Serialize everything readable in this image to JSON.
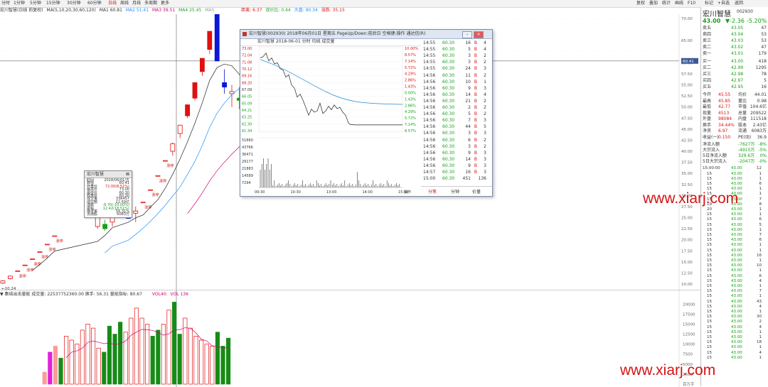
{
  "toolbar": {
    "periods": [
      "分时",
      "1分钟",
      "5分钟",
      "15分钟",
      "30分钟",
      "60分钟",
      "日线",
      "周线",
      "月线",
      "多周期",
      "更多"
    ],
    "right_tabs": [
      "复权",
      "叠加",
      "统计",
      "画线",
      "F10",
      "标记",
      "+自选",
      "返回"
    ]
  },
  "infobar": {
    "stock": "宏川智慧(日线 前复权)",
    "params": "MA(5,10,20,30,60,120)",
    "ma1": "MA1 60.81",
    "ma2": "MA2 51.41",
    "ma3": "MA3 39.51",
    "ma4": "MA4 25.45",
    "ma5": "MA5",
    "extra1": "距离: 6.37",
    "extra2": "现价比: 0.44",
    "extra3": "大盘: 90.34",
    "extra4": "涨跌: 35.15"
  },
  "price_axis": [
    "70.00",
    "65.00",
    "60.00",
    "57.50",
    "55.00",
    "52.50",
    "50.00",
    "47.50",
    "45.00",
    "42.50",
    "40.00",
    "37.50",
    "35.00",
    "32.50",
    "30.00",
    "27.50",
    "25.00",
    "22.50",
    "20.00",
    "17.50",
    "15.00",
    "12.50",
    "10.00"
  ],
  "main_chart": {
    "cursor_price": "60.41",
    "high_label": "73.00",
    "low_label": "10.24",
    "limit_up_label": "涨停"
  },
  "volume": {
    "info": "▼ 集结出击量能 成交量: 22537752360.00 换手: 56.31 量能指标: 80.67",
    "vol_label": "VOL40:",
    "vol_value": "VOL 136",
    "axis": [
      "20000",
      "17500",
      "15000",
      "12500",
      "10000",
      "7500",
      "5000",
      "2500"
    ],
    "unit": "百万手",
    "bars": [
      {
        "v": 3000,
        "c": "pink"
      },
      {
        "v": 8000,
        "c": "magenta"
      },
      {
        "v": 9500,
        "c": "pink"
      },
      {
        "v": 6500,
        "c": "green"
      },
      {
        "v": 12000,
        "c": "red"
      },
      {
        "v": 11000,
        "c": "red"
      },
      {
        "v": 10000,
        "c": "red"
      },
      {
        "v": 13500,
        "c": "red"
      },
      {
        "v": 15000,
        "c": "red"
      },
      {
        "v": 14000,
        "c": "red"
      },
      {
        "v": 9000,
        "c": "red"
      },
      {
        "v": 8000,
        "c": "green"
      },
      {
        "v": 14500,
        "c": "green"
      },
      {
        "v": 12500,
        "c": "green"
      },
      {
        "v": 15500,
        "c": "green"
      },
      {
        "v": 13000,
        "c": "red"
      },
      {
        "v": 16500,
        "c": "red"
      },
      {
        "v": 19000,
        "c": "red"
      },
      {
        "v": 16500,
        "c": "red"
      },
      {
        "v": 15000,
        "c": "red"
      },
      {
        "v": 12000,
        "c": "green"
      },
      {
        "v": 13500,
        "c": "green"
      },
      {
        "v": 15000,
        "c": "red"
      },
      {
        "v": 18500,
        "c": "red"
      },
      {
        "v": 20500,
        "c": "green"
      },
      {
        "v": 12500,
        "c": "green"
      },
      {
        "v": 16500,
        "c": "red"
      },
      {
        "v": 14000,
        "c": "red"
      },
      {
        "v": 12000,
        "c": "red"
      },
      {
        "v": 11000,
        "c": "red"
      },
      {
        "v": 10000,
        "c": "red"
      },
      {
        "v": 9500,
        "c": "red"
      },
      {
        "v": 13000,
        "c": "green"
      },
      {
        "v": 9500,
        "c": "green"
      },
      {
        "v": 11500,
        "c": "green"
      }
    ]
  },
  "candles": [
    {
      "o": 10.2,
      "h": 10.9,
      "l": 10.0,
      "c": 10.7,
      "col": "red"
    },
    {
      "o": 11.2,
      "h": 11.8,
      "l": 11.0,
      "c": 11.8,
      "col": "red"
    },
    {
      "o": 13.0,
      "h": 13.0,
      "l": 13.0,
      "c": 13.0,
      "col": "red"
    },
    {
      "o": 14.3,
      "h": 14.3,
      "l": 14.3,
      "c": 14.3,
      "col": "red"
    },
    {
      "o": 15.7,
      "h": 15.7,
      "l": 15.7,
      "c": 15.7,
      "col": "red"
    },
    {
      "o": 17.3,
      "h": 17.3,
      "l": 17.3,
      "c": 17.3,
      "col": "red"
    },
    {
      "o": 19.0,
      "h": 19.0,
      "l": 19.0,
      "c": 19.0,
      "col": "red"
    },
    {
      "o": 20.9,
      "h": 20.9,
      "l": 20.9,
      "c": 20.9,
      "col": "red"
    },
    {
      "o": 23.0,
      "h": 25.5,
      "l": 22.5,
      "c": 25.3,
      "col": "red"
    },
    {
      "o": 23.5,
      "h": 24.5,
      "l": 22.0,
      "c": 22.5,
      "col": "green"
    },
    {
      "o": 24.0,
      "h": 26.5,
      "l": 23.0,
      "c": 26.0,
      "col": "red"
    },
    {
      "o": 25.0,
      "h": 25.0,
      "l": 25.0,
      "c": 25.0,
      "col": "blue"
    },
    {
      "o": 26.5,
      "h": 27.5,
      "l": 24.0,
      "c": 26.0,
      "col": "red"
    },
    {
      "o": 28.5,
      "h": 28.5,
      "l": 28.5,
      "c": 28.5,
      "col": "red"
    },
    {
      "o": 31.3,
      "h": 31.3,
      "l": 31.3,
      "c": 31.3,
      "col": "red"
    },
    {
      "o": 34.5,
      "h": 34.5,
      "l": 34.5,
      "c": 34.5,
      "col": "red"
    },
    {
      "o": 37.9,
      "h": 37.9,
      "l": 37.9,
      "c": 37.9,
      "col": "red"
    },
    {
      "o": 40.0,
      "h": 42.0,
      "l": 39.0,
      "c": 41.7,
      "col": "red"
    },
    {
      "o": 44.0,
      "h": 46.0,
      "l": 43.0,
      "c": 45.9,
      "col": "red"
    },
    {
      "o": 48.0,
      "h": 50.5,
      "l": 47.5,
      "c": 50.5,
      "col": "red"
    },
    {
      "o": 52.0,
      "h": 55.5,
      "l": 51.5,
      "c": 55.5,
      "col": "red"
    },
    {
      "o": 58.0,
      "h": 61.0,
      "l": 57.0,
      "c": 61.0,
      "col": "red"
    },
    {
      "o": 63.0,
      "h": 67.0,
      "l": 62.0,
      "c": 67.1,
      "col": "red"
    },
    {
      "o": 73.0,
      "h": 73.0,
      "l": 60.4,
      "c": 60.4,
      "col": "blue"
    },
    {
      "o": 55.5,
      "h": 58.5,
      "l": 53.0,
      "c": 54.5,
      "col": "blue"
    },
    {
      "o": 53.0,
      "h": 55.0,
      "l": 50.0,
      "c": 53.5,
      "col": "red"
    },
    {
      "o": 52.0,
      "h": 54.5,
      "l": 49.5,
      "c": 51.5,
      "col": "green"
    },
    {
      "o": 50.5,
      "h": 53.0,
      "l": 48.5,
      "c": 52.5,
      "col": "red"
    },
    {
      "o": 51.0,
      "h": 52.5,
      "l": 48.0,
      "c": 51.5,
      "col": "red"
    },
    {
      "o": 53.5,
      "h": 55.0,
      "l": 51.5,
      "c": 52.5,
      "col": "blue"
    },
    {
      "o": 46.5,
      "h": 48.5,
      "l": 44.5,
      "c": 45.0,
      "col": "blue"
    },
    {
      "o": 45.0,
      "h": 45.0,
      "l": 42.8,
      "c": 43.0,
      "col": "green"
    }
  ],
  "popup": {
    "title": "宏川智慧(002930) 2018年06月01日 星期五 PageUp/Down:前后日 空格键:操作 通达信(R)",
    "subtitle": "宏川智慧  2018-06-01 分时  均线  成交量",
    "price_labels": [
      "73.00",
      "72.04",
      "71.08",
      "70.12",
      "69.16",
      "68.20",
      "67.09",
      "66.05",
      "65.09",
      "64.21",
      "63.25",
      "62.30",
      "61.34"
    ],
    "pct_labels": [
      "10.00%",
      "8.57%",
      "7.14%",
      "5.72%",
      "4.29%",
      "2.86%",
      "1.43%",
      "0.00%",
      "1.43%",
      "2.86%",
      "4.29%",
      "5.72%",
      "7.14%",
      "8.57%"
    ],
    "vol_labels": [
      "51660",
      "43766",
      "36471",
      "29177",
      "21883",
      "14589",
      "7294"
    ],
    "time_labels": [
      "09:30",
      "10:30",
      "13:00",
      "14:00",
      "15:00"
    ],
    "trades": [
      {
        "t": "14:55",
        "p": "60.30",
        "v": "16",
        "f": "B",
        "n": "4"
      },
      {
        "t": "14:55",
        "p": "60.30",
        "v": "5",
        "f": "B",
        "n": "4"
      },
      {
        "t": "14:55",
        "p": "60.30",
        "v": "3",
        "f": "B",
        "n": "2"
      },
      {
        "t": "14:55",
        "p": "60.30",
        "v": "3",
        "f": "B",
        "n": "2"
      },
      {
        "t": "14:55",
        "p": "60.30",
        "v": "24",
        "f": "B",
        "n": "3"
      },
      {
        "t": "14:56",
        "p": "60.30",
        "v": "11",
        "f": "B",
        "n": "2"
      },
      {
        "t": "14:56",
        "p": "60.30",
        "v": "10",
        "f": "B",
        "n": "1"
      },
      {
        "t": "14:56",
        "p": "60.30",
        "v": "9",
        "f": "B",
        "n": "3"
      },
      {
        "t": "14:56",
        "p": "60.30",
        "v": "14",
        "f": "B",
        "n": "4"
      },
      {
        "t": "14:56",
        "p": "60.30",
        "v": "21",
        "f": "B",
        "n": "2"
      },
      {
        "t": "14:56",
        "p": "60.30",
        "v": "2",
        "f": "B",
        "n": "2"
      },
      {
        "t": "14:56",
        "p": "60.30",
        "v": "5",
        "f": "B",
        "n": "2"
      },
      {
        "t": "14:56",
        "p": "60.30",
        "v": "7",
        "f": "B",
        "n": "3"
      },
      {
        "t": "14:56",
        "p": "60.30",
        "v": "44",
        "f": "B",
        "n": "5"
      },
      {
        "t": "14:56",
        "p": "60.30",
        "v": "3",
        "f": "B",
        "n": "3"
      },
      {
        "t": "14:56",
        "p": "60.30",
        "v": "6",
        "f": "B",
        "n": "2"
      },
      {
        "t": "14:56",
        "p": "60.30",
        "v": "3",
        "f": "B",
        "n": "2"
      },
      {
        "t": "14:56",
        "p": "60.30",
        "v": "9",
        "f": "B",
        "n": "3"
      },
      {
        "t": "14:56",
        "p": "60.30",
        "v": "14",
        "f": "B",
        "n": "3"
      },
      {
        "t": "14:56",
        "p": "60.30",
        "v": "9",
        "f": "B",
        "n": "3"
      },
      {
        "t": "14:57",
        "p": "60.30",
        "v": "16",
        "f": "B",
        "n": "3"
      },
      {
        "t": "15:00",
        "p": "60.30",
        "v": "451",
        "f": "",
        "n": "136"
      }
    ],
    "tabs": [
      "分笔",
      "分钟",
      "价量"
    ],
    "bottom_tab": "操作"
  },
  "infobox": {
    "title": "宏川智慧",
    "rows": [
      {
        "k": "时间",
        "v": "2018/06/01/五"
      },
      {
        "k": "数值",
        "v": "60.41"
      },
      {
        "k": "开盘价",
        "v": "72.00(8.51%)"
      },
      {
        "k": "最高价",
        "v": "73.00"
      },
      {
        "k": "最低价",
        "v": "60.30"
      },
      {
        "k": "收盘价",
        "v": "60.30"
      },
      {
        "k": "成交量",
        "v": "336457"
      },
      {
        "k": "成交额",
        "v": "22.59亿"
      },
      {
        "k": "涨跌",
        "v": "-6.70(-10.00%)"
      },
      {
        "k": "振幅",
        "v": "12.42(18.51%)"
      },
      {
        "k": "换手率",
        "v": "56.31%"
      },
      {
        "k": "流通股",
        "v": "6083万"
      }
    ]
  },
  "right_panel": {
    "name": "宏川智慧",
    "code": "002930",
    "price": "43.00",
    "change": "▼-2.36",
    "pct": "-5.20%",
    "asks": [
      {
        "k": "卖五",
        "p": "43.05",
        "v": "47"
      },
      {
        "k": "卖四",
        "p": "43.04",
        "v": "53"
      },
      {
        "k": "卖三",
        "p": "43.03",
        "v": "53"
      },
      {
        "k": "卖二",
        "p": "43.02",
        "v": "47"
      },
      {
        "k": "卖一",
        "p": "43.01",
        "v": "179"
      }
    ],
    "bids": [
      {
        "k": "买一",
        "p": "43.00",
        "v": "418"
      },
      {
        "k": "买二",
        "p": "42.99",
        "v": "1295"
      },
      {
        "k": "买三",
        "p": "42.98",
        "v": "78"
      },
      {
        "k": "买四",
        "p": "42.97",
        "v": "5"
      },
      {
        "k": "买五",
        "p": "42.95",
        "v": "16"
      }
    ],
    "stats": [
      {
        "a": "今开",
        "b": "45.55",
        "c": "均价",
        "d": "44.01"
      },
      {
        "a": "最高",
        "b": "45.85",
        "c": "量比",
        "d": "0.98"
      },
      {
        "a": "最低",
        "b": "42.77",
        "c": "市值",
        "d": "104.6亿"
      },
      {
        "a": "现量",
        "b": "4513",
        "c": "总量",
        "d": "209522"
      },
      {
        "a": "外盘",
        "b": "98084",
        "c": "内盘",
        "d": "111518"
      },
      {
        "a": "换手",
        "b": "34.44%",
        "c": "股本",
        "d": "2.43亿"
      },
      {
        "a": "净资",
        "b": "6.97",
        "c": "流通",
        "d": "6083万"
      },
      {
        "a": "收益(一)",
        "b": "0.150",
        "c": "PE(动)",
        "d": "36.9"
      }
    ],
    "flows": [
      {
        "k": "净流入额",
        "v": "-7627万",
        "p": "-8%"
      },
      {
        "k": "大宗流入",
        "v": "-4915万",
        "p": "-5%"
      },
      {
        "k": "5日净流入额",
        "v": "329.6万",
        "p": "0%"
      },
      {
        "k": "5日大宗流入",
        "v": "-2047万",
        "p": "-0%"
      }
    ],
    "ticks_header": {
      "t": "15:00:00",
      "p": "43.00",
      "v": "12"
    },
    "ticks": [
      {
        "t": "15",
        "p": "43.00",
        "v": "1"
      },
      {
        "t": "15",
        "p": "43.00",
        "v": "1"
      },
      {
        "t": "15",
        "p": "43.00",
        "v": "6"
      },
      {
        "t": "15",
        "p": "43.00",
        "v": "1"
      },
      {
        "t": "15",
        "p": "43.00",
        "v": "1"
      },
      {
        "t": "15",
        "p": "43.00",
        "v": "7"
      },
      {
        "t": "19",
        "p": "43.00",
        "v": "8"
      },
      {
        "t": "20",
        "p": "43.00",
        "v": "1"
      },
      {
        "t": "15",
        "p": "43.00",
        "v": "1"
      },
      {
        "t": "15",
        "p": "43.00",
        "v": "6"
      },
      {
        "t": "15",
        "p": "43.00",
        "v": "5"
      },
      {
        "t": "15",
        "p": "43.00",
        "v": "1"
      },
      {
        "t": "15",
        "p": "43.00",
        "v": "7"
      },
      {
        "t": "15",
        "p": "43.00",
        "v": "6"
      },
      {
        "t": "15",
        "p": "43.00",
        "v": "1"
      },
      {
        "t": "15",
        "p": "43.00",
        "v": "1"
      },
      {
        "t": "15",
        "p": "43.00",
        "v": "16"
      },
      {
        "t": "15",
        "p": "43.00",
        "v": "1"
      },
      {
        "t": "15",
        "p": "43.00",
        "v": "10"
      },
      {
        "t": "15",
        "p": "43.00",
        "v": "1"
      },
      {
        "t": "15",
        "p": "43.00",
        "v": "6"
      },
      {
        "t": "15",
        "p": "43.00",
        "v": "4"
      },
      {
        "t": "15",
        "p": "43.00",
        "v": "1"
      },
      {
        "t": "15",
        "p": "43.00",
        "v": "7"
      },
      {
        "t": "15",
        "p": "43.00",
        "v": "1"
      },
      {
        "t": "15",
        "p": "43.00",
        "v": "43"
      },
      {
        "t": "15",
        "p": "43.00",
        "v": "4"
      },
      {
        "t": "15",
        "p": "43.00",
        "v": "1"
      },
      {
        "t": "15",
        "p": "43.00",
        "v": "30"
      },
      {
        "t": "15",
        "p": "43.00",
        "v": "2"
      },
      {
        "t": "15",
        "p": "43.00",
        "v": "4"
      },
      {
        "t": "15",
        "p": "43.00",
        "v": "1"
      },
      {
        "t": "15",
        "p": "43.00",
        "v": "1"
      },
      {
        "t": "15",
        "p": "43.00",
        "v": "18"
      },
      {
        "t": "15",
        "p": "43.00",
        "v": "1"
      },
      {
        "t": "15",
        "p": "43.00",
        "v": "4"
      },
      {
        "t": "15",
        "p": "43.00",
        "v": "1"
      }
    ]
  },
  "watermarks": [
    "www.xiarj.com",
    "www.xiarj.com"
  ]
}
